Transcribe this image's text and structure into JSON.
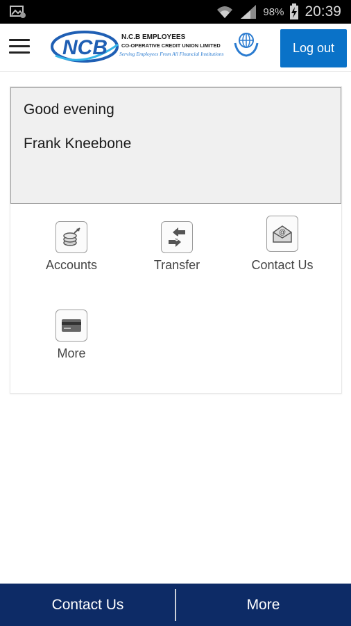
{
  "status_bar": {
    "battery_percent": "98%",
    "time": "20:39",
    "icons": [
      "notification-image-icon",
      "wifi-icon",
      "signal-icon",
      "battery-charging-icon"
    ]
  },
  "header": {
    "logo": {
      "initials": "NCB",
      "org_name": "N.C.B EMPLOYEES",
      "org_subtitle": "CO-OPERATIVE CREDIT UNION LIMITED",
      "tagline": "Serving Employees From All Financial Institutions"
    },
    "logout_label": "Log out"
  },
  "greeting": {
    "salutation": "Good evening",
    "user_name": "Frank Kneebone"
  },
  "tiles": [
    {
      "label": "Accounts",
      "icon": "coins-icon"
    },
    {
      "label": "Transfer",
      "icon": "money-transfer-icon"
    },
    {
      "label": "Contact Us",
      "icon": "envelope-at-icon"
    },
    {
      "label": "More",
      "icon": "credit-card-icon"
    }
  ],
  "bottom_nav": {
    "contact_label": "Contact Us",
    "more_label": "More"
  },
  "colors": {
    "primary_button": "#0a72c8",
    "bottom_bar": "#0d2b66",
    "logo_blue": "#1f5fb4"
  }
}
